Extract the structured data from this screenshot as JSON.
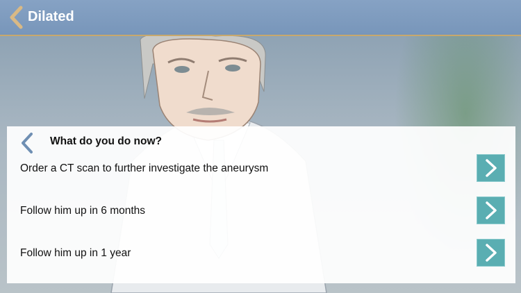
{
  "header": {
    "title": "Dilated"
  },
  "panel": {
    "question": "What do you do now?",
    "options": [
      {
        "label": "Order a CT scan to further investigate the aneurysm"
      },
      {
        "label": "Follow him up in 6 months"
      },
      {
        "label": "Follow him up in 1 year"
      }
    ]
  },
  "colors": {
    "header_bg": "#7896ba",
    "header_border": "#c8a86c",
    "accent_button": "#5aaeb2",
    "back_chevron_header": "#d9b985",
    "back_chevron_panel": "#6f8fb3"
  }
}
